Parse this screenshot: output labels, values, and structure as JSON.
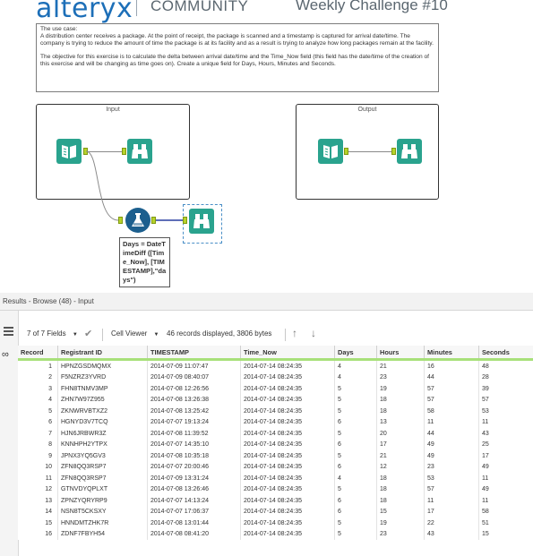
{
  "header": {
    "logo": "alteryx",
    "community": "COMMUNITY",
    "challenge": "Weekly Challenge #10"
  },
  "usecase": {
    "heading": "The use case:",
    "para1": "A distribution center receives a package. At the point of receipt, the package is scanned and a timestamp is captured for arrival date/time. The company is trying to reduce the amount of time the package is at its facility and as a result is trying to analyze how long packages remain at the facility.",
    "para2": "The objective for this exercise is to calculate the delta between arrival date/time and the Time_Now field (this field has the date/time of the creation of this exercise and will be changing as time goes on). Create a unique field for Days, Hours, Minutes and Seconds."
  },
  "workflow": {
    "input_container": "Input",
    "output_container": "Output",
    "formula_expression": "Days = DateTimeDiff ([Time_Now], [TIMESTAMP],\"da ys\")"
  },
  "results": {
    "title": "Results - Browse (48) - Input",
    "fields_label": "7 of 7 Fields",
    "viewer_label": "Cell Viewer",
    "records_info": "46 records displayed, 3806 bytes",
    "columns": [
      "Record",
      "Registrant ID",
      "TIMESTAMP",
      "Time_Now",
      "Days",
      "Hours",
      "Minutes",
      "Seconds"
    ],
    "rows": [
      [
        "1",
        "HPNZGSDMQMX",
        "2014-07-09 11:07:47",
        "2014-07-14 08:24:35",
        "4",
        "21",
        "16",
        "48"
      ],
      [
        "2",
        "F5NZRZ3YVRD",
        "2014-07-09 08:40:07",
        "2014-07-14 08:24:35",
        "4",
        "23",
        "44",
        "28"
      ],
      [
        "3",
        "FHN8TNMV3MP",
        "2014-07-08 12:26:56",
        "2014-07-14 08:24:35",
        "5",
        "19",
        "57",
        "39"
      ],
      [
        "4",
        "ZHN7W97Z955",
        "2014-07-08 13:26:38",
        "2014-07-14 08:24:35",
        "5",
        "18",
        "57",
        "57"
      ],
      [
        "5",
        "ZKNWRVBTXZ2",
        "2014-07-08 13:25:42",
        "2014-07-14 08:24:35",
        "5",
        "18",
        "58",
        "53"
      ],
      [
        "6",
        "HGNYD3V7TCQ",
        "2014-07-07 19:13:24",
        "2014-07-14 08:24:35",
        "6",
        "13",
        "11",
        "11"
      ],
      [
        "7",
        "HJN6JRBWR3Z",
        "2014-07-08 11:39:52",
        "2014-07-14 08:24:35",
        "5",
        "20",
        "44",
        "43"
      ],
      [
        "8",
        "KNNHPH2YTPX",
        "2014-07-07 14:35:10",
        "2014-07-14 08:24:35",
        "6",
        "17",
        "49",
        "25"
      ],
      [
        "9",
        "JPNX3YQ5GV3",
        "2014-07-08 10:35:18",
        "2014-07-14 08:24:35",
        "5",
        "21",
        "49",
        "17"
      ],
      [
        "10",
        "ZFN8QQ3RSP7",
        "2014-07-07 20:00:46",
        "2014-07-14 08:24:35",
        "6",
        "12",
        "23",
        "49"
      ],
      [
        "11",
        "ZFN8QQ3RSP7",
        "2014-07-09 13:31:24",
        "2014-07-14 08:24:35",
        "4",
        "18",
        "53",
        "11"
      ],
      [
        "12",
        "GTNVDYQPLXT",
        "2014-07-08 13:26:46",
        "2014-07-14 08:24:35",
        "5",
        "18",
        "57",
        "49"
      ],
      [
        "13",
        "ZPNZYQRYRP9",
        "2014-07-07 14:13:24",
        "2014-07-14 08:24:35",
        "6",
        "18",
        "11",
        "11"
      ],
      [
        "14",
        "NSN8T5CKSXY",
        "2014-07-07 17:06:37",
        "2014-07-14 08:24:35",
        "6",
        "15",
        "17",
        "58"
      ],
      [
        "15",
        "HNNDMTZHK7R",
        "2014-07-08 13:01:44",
        "2014-07-14 08:24:35",
        "5",
        "19",
        "22",
        "51"
      ],
      [
        "16",
        "ZDNF7FBYH54",
        "2014-07-08 08:41:20",
        "2014-07-14 08:24:35",
        "5",
        "23",
        "43",
        "15"
      ]
    ]
  },
  "colors": {
    "brand": "#1d6fb8",
    "tool": "#2aa38e",
    "formula": "#1c5f8e",
    "header_accent": "#a8e07a"
  }
}
